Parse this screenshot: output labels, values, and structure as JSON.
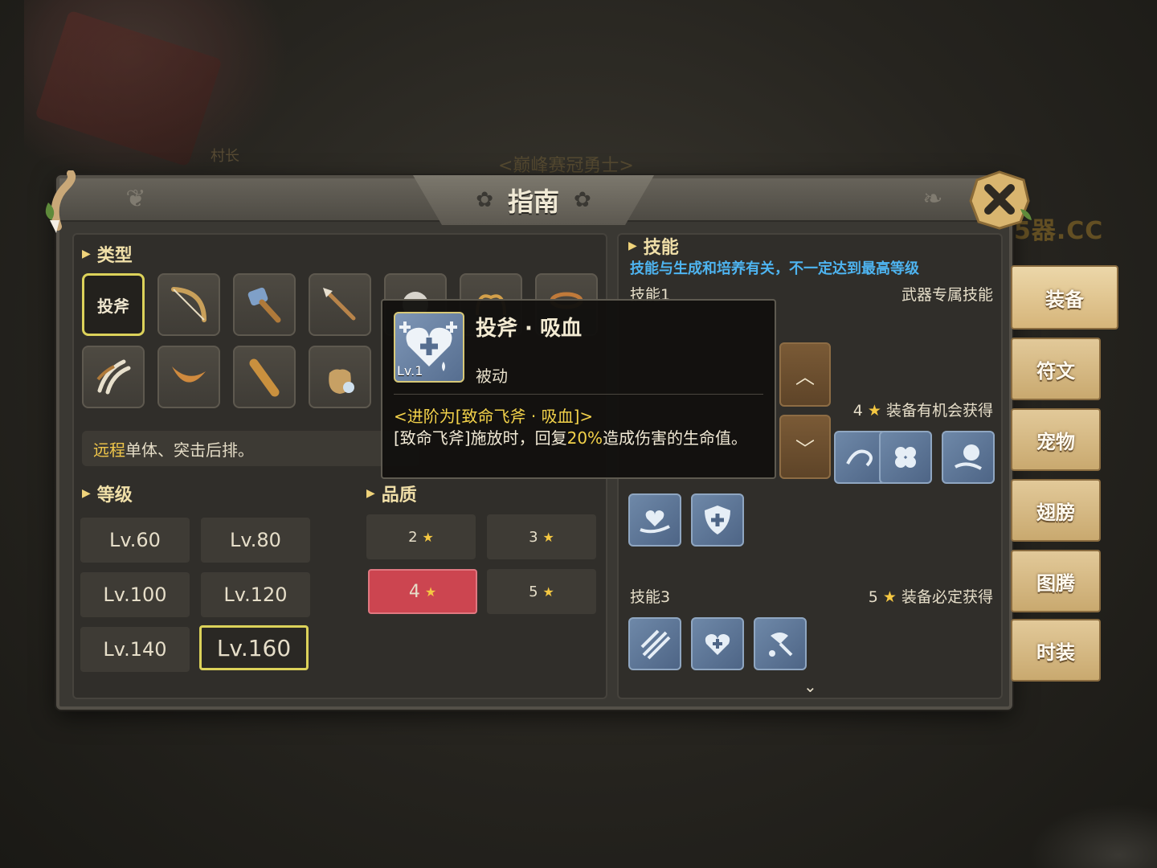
{
  "background": {
    "npc_name": "村长",
    "player_title": "<巅峰赛冠勇士>",
    "watermark": "5器.CC"
  },
  "header": {
    "title": "指南"
  },
  "type_section": {
    "heading": "类型",
    "selected_label": "投斧",
    "items": [
      {
        "name": "throwing-axe",
        "label": "投斧"
      },
      {
        "name": "bow-icon"
      },
      {
        "name": "hammer-icon"
      },
      {
        "name": "spear-icon"
      },
      {
        "name": "orb-icon"
      },
      {
        "name": "whip-icon"
      },
      {
        "name": "lasso-icon"
      },
      {
        "name": "claw-icon"
      },
      {
        "name": "boomerang-icon"
      },
      {
        "name": "club-icon"
      },
      {
        "name": "bag-icon"
      }
    ],
    "description_highlight": "远程",
    "description_rest": "单体、突击后排。"
  },
  "level_section": {
    "heading": "等级",
    "levels": [
      "Lv.60",
      "Lv.80",
      "Lv.100",
      "Lv.120",
      "Lv.140",
      "Lv.160"
    ],
    "selected": "Lv.160"
  },
  "quality_section": {
    "heading": "品质",
    "options": [
      "2",
      "3",
      "4",
      "5"
    ],
    "selected": "4"
  },
  "skill_section": {
    "heading": "技能",
    "hint": "技能与生成和培养有关，不一定达到最高等级",
    "skill1_label": "技能1",
    "skill1_note": "武器专属技能",
    "skill2_note_stars": "4",
    "skill2_note": "装备有机会获得",
    "skill3_label": "技能3",
    "skill3_note_stars": "5",
    "skill3_note": "装备必定获得"
  },
  "tooltip": {
    "skill_name": "投斧 · 吸血",
    "level": "Lv.1",
    "kind": "被动",
    "upgrade": "<进阶为[致命飞斧 · 吸血]>",
    "effect_pre": "[致命飞斧]施放时，回复",
    "effect_pct": "20%",
    "effect_post": "造成伤害的生命值。"
  },
  "side_tabs": [
    "装备",
    "符文",
    "宠物",
    "翅膀",
    "图腾",
    "时装"
  ],
  "active_tab": "装备",
  "colors": {
    "accent_yellow": "#dcd25a",
    "quality_selected": "#cc4550",
    "hint_blue": "#4eb4f0",
    "tab_gold": "#d6b57a"
  }
}
